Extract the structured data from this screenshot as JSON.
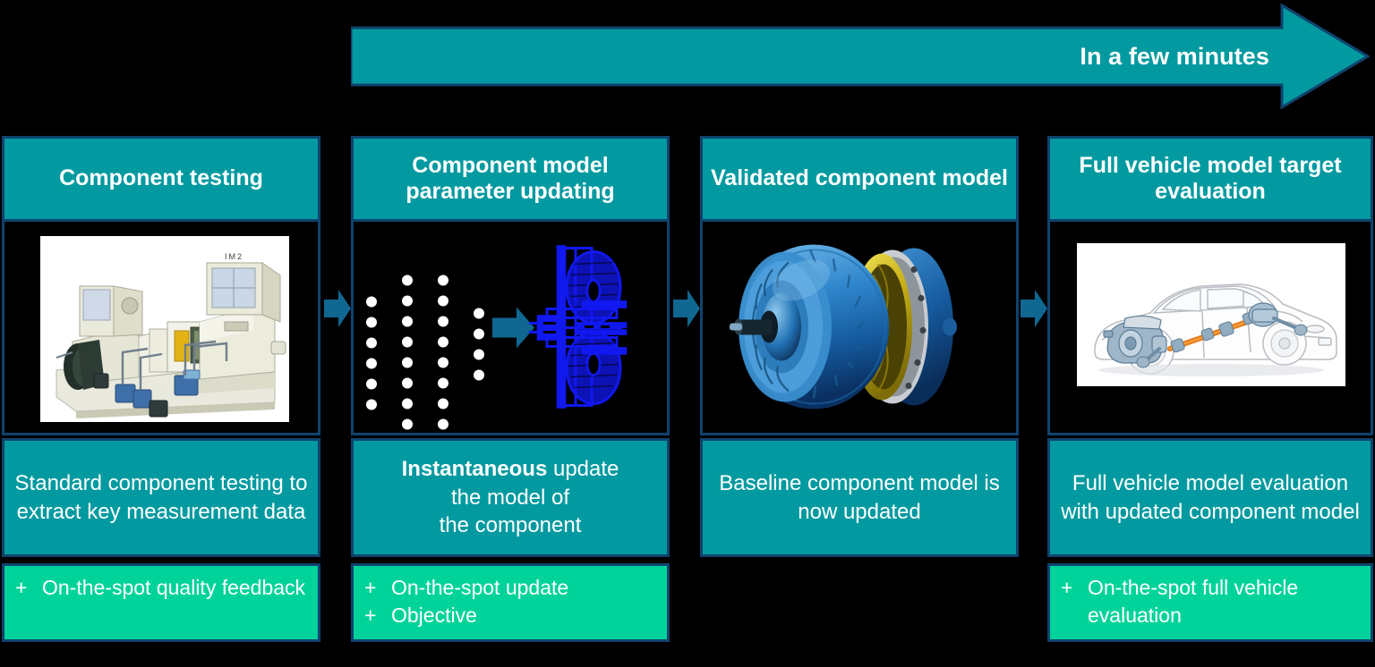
{
  "timeline": {
    "label": "In a few minutes",
    "arrow_icon": "right-arrow-icon",
    "color": "#029aa0"
  },
  "theme": {
    "header_bg": "#029aa0",
    "border": "#10436e",
    "benefit_bg": "#00d39a",
    "canvas_bg": "#000000",
    "text": "#ffffff",
    "connector": "#106792"
  },
  "columns": [
    {
      "title": "Component testing",
      "media": {
        "kind": "photo",
        "name": "test-bench-photo",
        "alt": "Component test bench machine"
      },
      "description_plain": "Standard component testing to extract key measurement data",
      "description_lines": [
        "Standard component",
        "testing to extract key",
        "measurement data"
      ],
      "description_bold_prefix": "",
      "benefits": [
        "On-the-spot quality feedback"
      ],
      "benefit_marker": "+"
    },
    {
      "title": "Component model parameter updating",
      "media": {
        "kind": "diagram",
        "name": "neural-network-diagram",
        "alt": "Neural network feeding a torque converter schematic"
      },
      "description_plain": "Instantaneous update the model of the component",
      "description_lines": [
        "update",
        "the model of",
        "the component"
      ],
      "description_bold_prefix": "Instantaneous",
      "benefits": [
        "On-the-spot update",
        "Objective"
      ],
      "benefit_marker": "+"
    },
    {
      "title": "Validated component model",
      "media": {
        "kind": "render",
        "name": "torque-converter-render",
        "alt": "3D torque converter cutaway render"
      },
      "description_plain": "Baseline component model is now updated",
      "description_lines": [
        "Baseline component",
        "model is now updated"
      ],
      "description_bold_prefix": "",
      "benefits": [],
      "benefit_marker": "+"
    },
    {
      "title": "Full vehicle model target evaluation",
      "media": {
        "kind": "illustration",
        "name": "vehicle-driveline-illustration",
        "alt": "Sedan outline with driveline highlighted"
      },
      "description_plain": "Full vehicle model evaluation with updated component model",
      "description_lines": [
        "Full vehicle model",
        "evaluation with updated",
        "component model"
      ],
      "description_bold_prefix": "",
      "benefits": [
        "On-the-spot full vehicle evaluation"
      ],
      "benefit_marker": "+"
    }
  ],
  "connectors": [
    {
      "name": "connector-arrow-1",
      "icon": "right-arrow-icon"
    },
    {
      "name": "connector-arrow-2",
      "icon": "right-arrow-icon"
    },
    {
      "name": "connector-arrow-3",
      "icon": "right-arrow-icon"
    }
  ],
  "neural_network": {
    "layer_counts": [
      6,
      9,
      9,
      4
    ],
    "node_color": "#ffffff",
    "arrow_color": "#106792",
    "schematic_color": "#1118f0"
  }
}
